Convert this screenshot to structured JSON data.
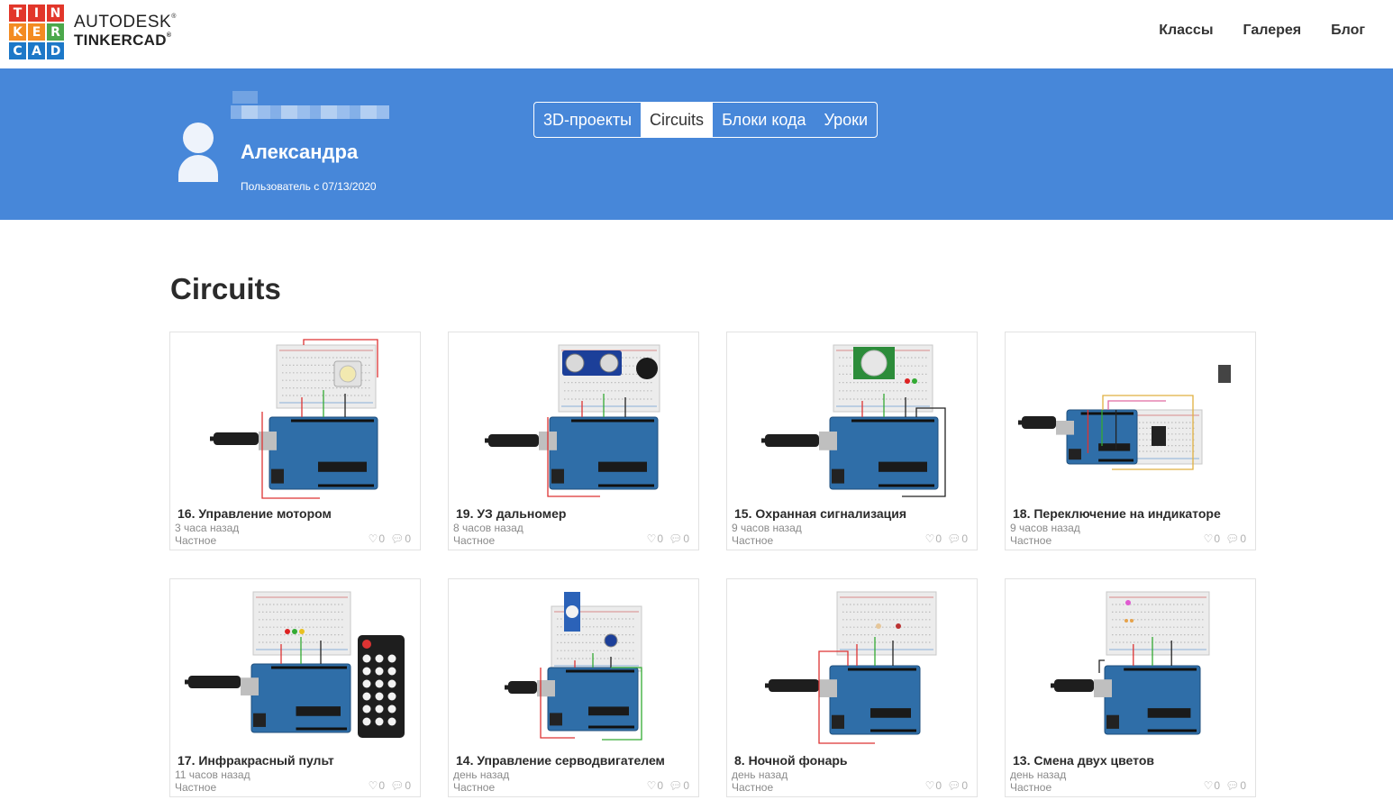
{
  "logo": {
    "letters": [
      "T",
      "I",
      "N",
      "K",
      "E",
      "R",
      "C",
      "A",
      "D"
    ],
    "colors": [
      "#e2362a",
      "#e2362a",
      "#e2362a",
      "#f38b22",
      "#f38b22",
      "#4ba84b",
      "#1d78c8",
      "#1d78c8",
      "#1d78c8"
    ]
  },
  "brand": {
    "line1": "AUTODESK",
    "line2": "TINKERCAD",
    "reg": "®"
  },
  "nav": [
    "Классы",
    "Галерея",
    "Блог"
  ],
  "profile": {
    "name": "Александра",
    "since": "Пользователь с 07/13/2020"
  },
  "tabs": [
    {
      "label": "3D-проекты",
      "active": false
    },
    {
      "label": "Circuits",
      "active": true
    },
    {
      "label": "Блоки кода",
      "active": false
    },
    {
      "label": "Уроки",
      "active": false
    }
  ],
  "section_title": "Circuits",
  "cards": [
    {
      "title": "16. Управление мотором",
      "time": "3 часа назад",
      "privacy": "Частное",
      "likes": "0",
      "comments": "0"
    },
    {
      "title": "19. УЗ дальномер",
      "time": "8 часов назад",
      "privacy": "Частное",
      "likes": "0",
      "comments": "0"
    },
    {
      "title": "15. Охранная сигнализация",
      "time": "9 часов назад",
      "privacy": "Частное",
      "likes": "0",
      "comments": "0"
    },
    {
      "title": "18. Переключение на индикаторе",
      "time": "9 часов назад",
      "privacy": "Частное",
      "likes": "0",
      "comments": "0"
    },
    {
      "title": "17. Инфракрасный пульт",
      "time": "11 часов назад",
      "privacy": "Частное",
      "likes": "0",
      "comments": "0"
    },
    {
      "title": "14. Управление серводвигателем",
      "time": "день назад",
      "privacy": "Частное",
      "likes": "0",
      "comments": "0"
    },
    {
      "title": "8. Ночной фонарь",
      "time": "день назад",
      "privacy": "Частное",
      "likes": "0",
      "comments": "0"
    },
    {
      "title": "13. Смена двух цветов",
      "time": "день назад",
      "privacy": "Частное",
      "likes": "0",
      "comments": "0"
    }
  ],
  "colors": {
    "band": "#4787d9",
    "arduino": "#2f6ea8",
    "breadboard": "#ececec"
  }
}
